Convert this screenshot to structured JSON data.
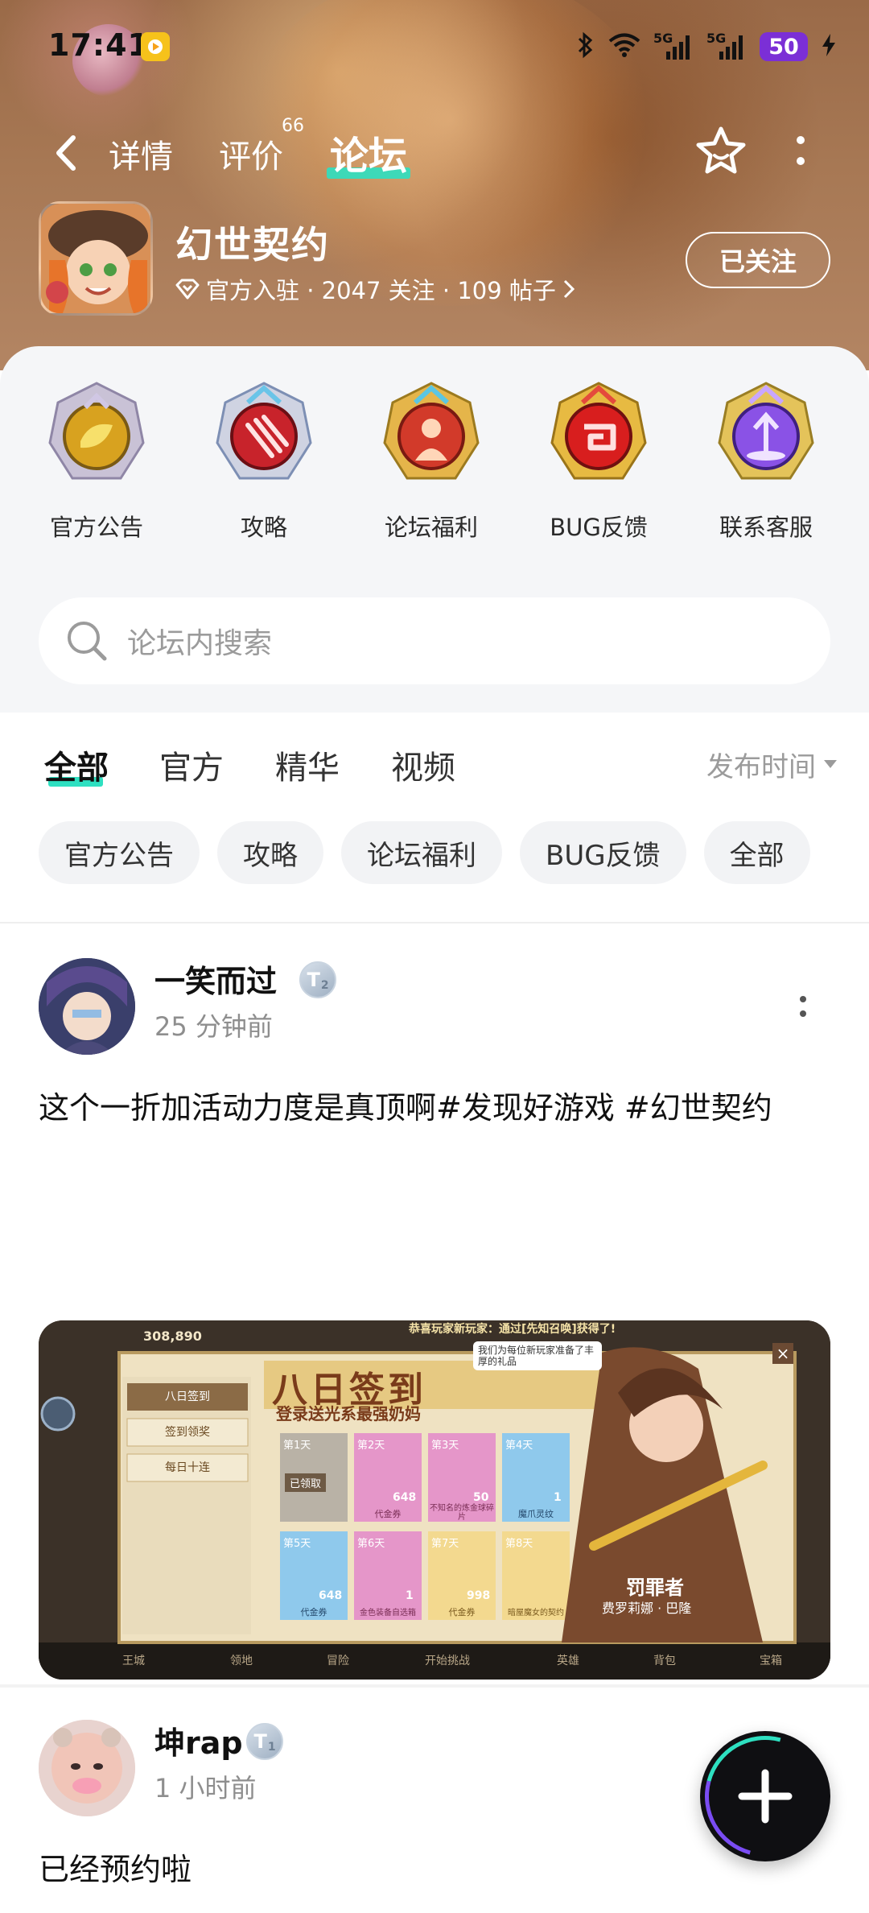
{
  "status_bar": {
    "time": "17:41",
    "network_1": "5G",
    "network_2": "5G",
    "battery": "50"
  },
  "nav": {
    "tabs": [
      {
        "label": "详情"
      },
      {
        "label": "评价",
        "count": "66"
      },
      {
        "label": "论坛"
      }
    ],
    "active_tab": "论坛"
  },
  "game": {
    "title": "幻世契约",
    "meta": "官方入驻 · 2047 关注 · 109 帖子",
    "follow_label": "已关注"
  },
  "quick_links": [
    {
      "label": "官方公告",
      "color": "#d8a21f"
    },
    {
      "label": "攻略",
      "color": "#c8232b"
    },
    {
      "label": "论坛福利",
      "color": "#d23a2a"
    },
    {
      "label": "BUG反馈",
      "color": "#d81e1e"
    },
    {
      "label": "联系客服",
      "color": "#8a52e6"
    }
  ],
  "search": {
    "placeholder": "论坛内搜索"
  },
  "feed_tabs": [
    "全部",
    "官方",
    "精华",
    "视频"
  ],
  "sort_label": "发布时间",
  "chips": [
    "官方公告",
    "攻略",
    "论坛福利",
    "BUG反馈",
    "全部"
  ],
  "posts": [
    {
      "user": "一笑而过",
      "level": "2",
      "time": "25 分钟前",
      "text": "这个一折加活动力度是真顶啊#发现好游戏 #幻世契约",
      "image": {
        "score": "308,890",
        "banner": "恭喜玩家新玩家：通过[先知召唤]获得了!",
        "title": "八日签到",
        "subtitle": "登录送光系最强奶妈",
        "speech": "我们为每位新玩家准备了丰厚的礼品",
        "menu": [
          "八日签到",
          "签到领奖",
          "每日十连"
        ],
        "days": [
          {
            "day": "第1天",
            "name": "",
            "qty": "",
            "status": "已领取"
          },
          {
            "day": "第2天",
            "name": "代金券",
            "qty": "648"
          },
          {
            "day": "第3天",
            "name": "不知名的炼金球碎片",
            "qty": "50"
          },
          {
            "day": "第4天",
            "name": "魔爪灵纹",
            "qty": "1"
          },
          {
            "day": "第5天",
            "name": "代金券",
            "qty": "648"
          },
          {
            "day": "第6天",
            "name": "金色装备自选箱",
            "qty": "1"
          },
          {
            "day": "第7天",
            "name": "代金券",
            "qty": "998"
          },
          {
            "day": "第8天",
            "name": "暗屋魔女的契约",
            "qty": ""
          }
        ],
        "hero_title": "罚罪者",
        "hero_name": "费罗莉娜 · 巴隆",
        "bottom_tabs": [
          "王城",
          "领地",
          "冒险",
          "开始挑战",
          "英雄",
          "背包",
          "宝箱"
        ]
      }
    },
    {
      "user": "坤rap",
      "level": "1",
      "time": "1 小时前",
      "text": "已经预约啦"
    }
  ]
}
